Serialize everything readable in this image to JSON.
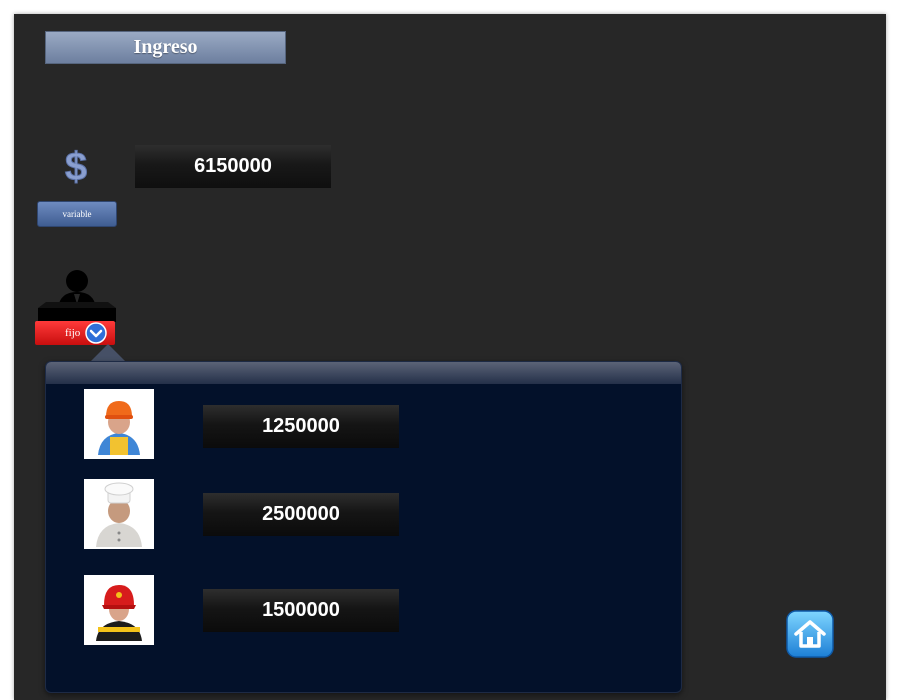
{
  "header": {
    "title": "Ingreso"
  },
  "income": {
    "total_value": "6150000",
    "variable_label": "variable",
    "fijo_label": "fijo"
  },
  "popup": {
    "workers": [
      {
        "icon": "construction-worker-icon",
        "value": "1250000"
      },
      {
        "icon": "chef-icon",
        "value": "2500000"
      },
      {
        "icon": "firefighter-icon",
        "value": "1500000"
      }
    ]
  },
  "colors": {
    "background": "#272727",
    "title_bar": "#7f90ad",
    "variable_button": "#4f6ea4",
    "fijo_button": "#e01b1b",
    "popup_bg": "#03112a"
  },
  "icons": {
    "income": "dollar-icon",
    "fixed": "person-icon",
    "dropdown": "chevron-down-icon",
    "home": "home-icon"
  }
}
